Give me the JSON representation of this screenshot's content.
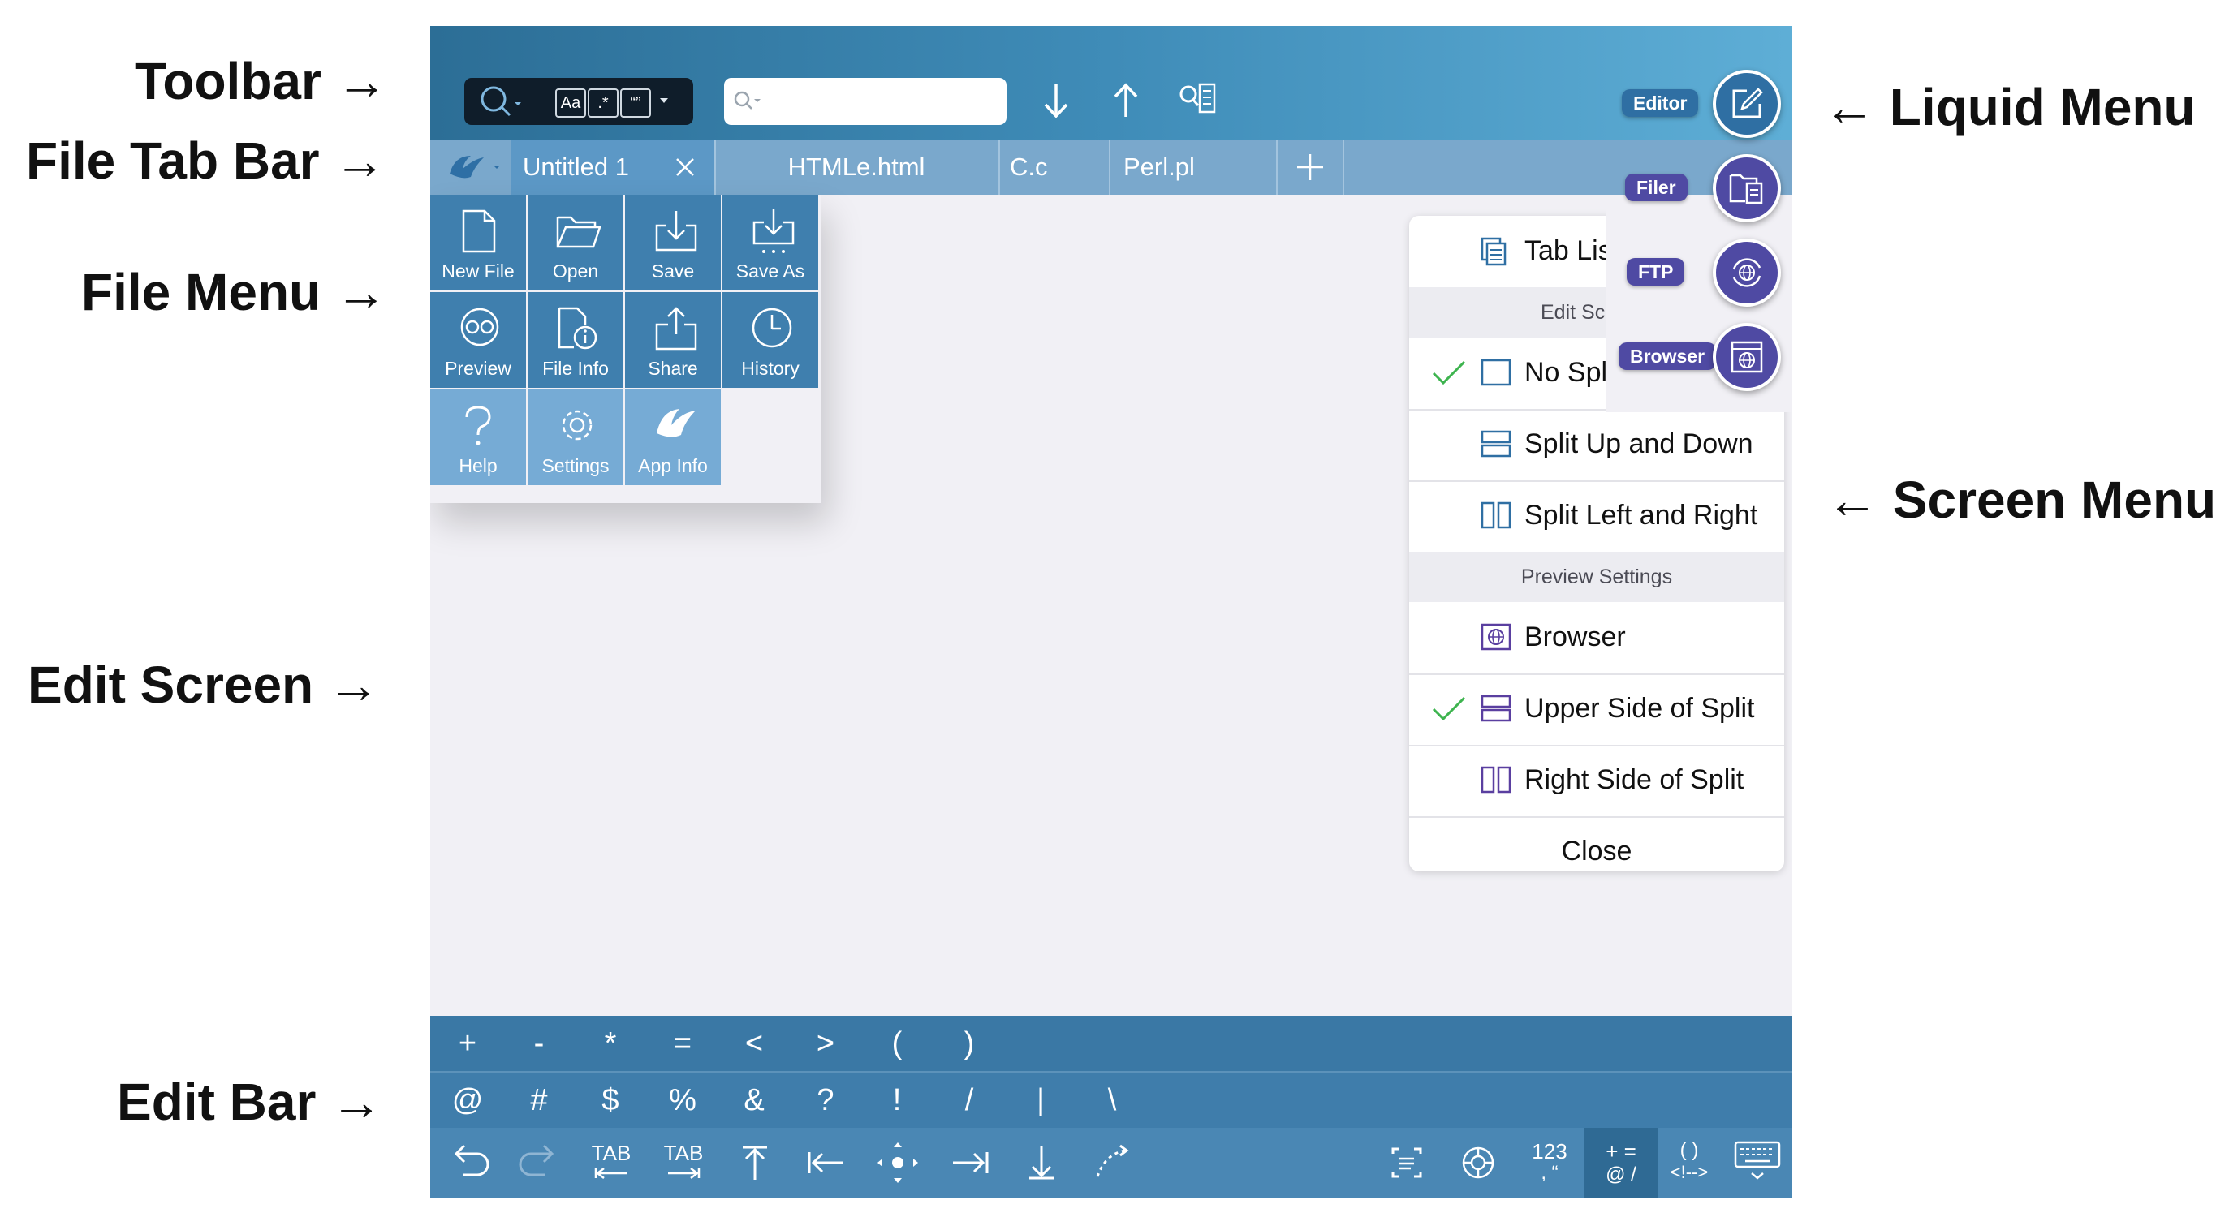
{
  "annotations": {
    "toolbar": "Toolbar →",
    "file_tab_bar": "File Tab Bar →",
    "file_menu": "File Menu →",
    "edit_screen": "Edit Screen →",
    "edit_bar": "Edit Bar →",
    "liquid_menu": "← Liquid Menu",
    "screen_menu": "← Screen Menu"
  },
  "toolbar": {
    "search_option_case": "Aa",
    "search_option_regex": ".*",
    "search_option_quote": "“”",
    "search_placeholder": ""
  },
  "tabs": [
    {
      "label": "Untitled 1",
      "active": true
    },
    {
      "label": "HTMLe.html",
      "active": false
    },
    {
      "label": "C.c",
      "active": false
    },
    {
      "label": "Perl.pl",
      "active": false
    }
  ],
  "file_menu": {
    "items": [
      {
        "label": "New File",
        "icon": "new-file-icon"
      },
      {
        "label": "Open",
        "icon": "folder-open-icon"
      },
      {
        "label": "Save",
        "icon": "save-icon"
      },
      {
        "label": "Save As",
        "icon": "save-as-icon"
      },
      {
        "label": "Preview",
        "icon": "preview-icon"
      },
      {
        "label": "File Info",
        "icon": "file-info-icon"
      },
      {
        "label": "Share",
        "icon": "share-icon"
      },
      {
        "label": "History",
        "icon": "history-icon"
      },
      {
        "label": "Help",
        "icon": "help-icon"
      },
      {
        "label": "Settings",
        "icon": "settings-icon"
      },
      {
        "label": "App Info",
        "icon": "app-logo-icon"
      }
    ]
  },
  "screen_menu": {
    "tab_list": "Tab Lis",
    "edit_section": "Edit Sc",
    "no_split": "No Spl",
    "split_up_down": "Split Up and Down",
    "split_left_right": "Split Left and Right",
    "preview_section": "Preview Settings",
    "browser": "Browser",
    "upper_side": "Upper Side of Split",
    "right_side": "Right Side of Split",
    "close": "Close"
  },
  "liquid_menu": {
    "editor": "Editor",
    "filer": "Filer",
    "ftp": "FTP",
    "browser": "Browser"
  },
  "edit_bar": {
    "row1": [
      "+",
      "-",
      "*",
      "=",
      "<",
      ">",
      "(",
      ")"
    ],
    "row2": [
      "@",
      "#",
      "$",
      "%",
      "&",
      "?",
      "!",
      "/",
      "|",
      "\\"
    ],
    "tab_left": "TAB",
    "tab_right": "TAB",
    "num_top": "123",
    "num_bottom": ", “",
    "sym_top": "+ =",
    "sym_bottom": "@ /",
    "snip_top": "( )",
    "snip_bottom": "<!-->"
  },
  "colors": {
    "toolbar_start": "#2c6e96",
    "toolbar_end": "#5eaed6",
    "file_menu_tile": "#3f7fae",
    "file_menu_tile_light": "#76abd5",
    "edit_bar": "#3a78a5",
    "liquid_editor": "#2f6fa3",
    "liquid_other": "#4f4aa3",
    "check_green": "#3eb44f"
  }
}
